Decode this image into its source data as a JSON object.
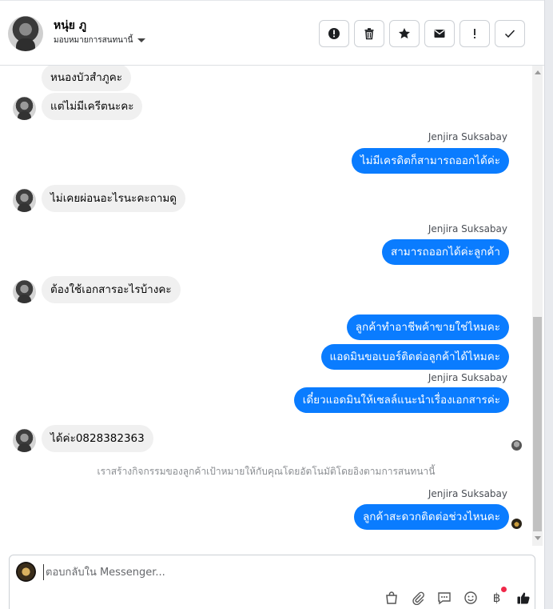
{
  "contact": {
    "name": "หนุ่ย ภู",
    "assignment": "มอบหมายการสนทนานี้"
  },
  "header_actions": [
    {
      "icon": "alert-circle-icon",
      "glyph": "!"
    },
    {
      "icon": "trash-icon"
    },
    {
      "icon": "star-icon"
    },
    {
      "icon": "envelope-icon"
    },
    {
      "icon": "exclamation-icon",
      "glyph": "!"
    },
    {
      "icon": "check-icon"
    }
  ],
  "messages": {
    "m1": "หนองบัวสำภูคะ",
    "m2": "แต่ไม่มีเครีตนะคะ",
    "m3_sender": "Jenjira Suksabay",
    "m3": "ไม่มีเครดิตก็สามารถออกได้ค่ะ",
    "m4": "ไม่เคยผ่อนอะไรนะคะถามดู",
    "m5_sender": "Jenjira Suksabay",
    "m5": "สามารถออกได้ค่ะลูกค้า",
    "m6": "ต้องใช้เอกสารอะไรบ้างคะ",
    "m7": "ลูกค้าทำอาชีพค้าขายใช่ไหมคะ",
    "m8": "แอดมินขอเบอร์ติดต่อลูกค้าได้ไหมคะ",
    "m9_sender": "Jenjira Suksabay",
    "m9": "เดี๋ยวแอดมินให้เซลล์แนะนำเรื่องเอกสารค่ะ",
    "m10": "ได้ค่ะ0828382363",
    "system_note": "เราสร้างกิจกรรมของลูกค้าเป้าหมายให้กับคุณโดยอัตโนมัติโดยอิงตามการสนทนานี้",
    "m11_sender": "Jenjira Suksabay",
    "m11": "ลูกค้าสะดวกติดต่อช่วงไหนคะ"
  },
  "composer": {
    "placeholder": "ตอบกลับใน Messenger...",
    "value": "",
    "currency_symbol": "฿"
  },
  "colors": {
    "outgoing_bubble": "#0a7cff",
    "incoming_bubble": "#f0f0f0",
    "badge": "#f02849"
  }
}
